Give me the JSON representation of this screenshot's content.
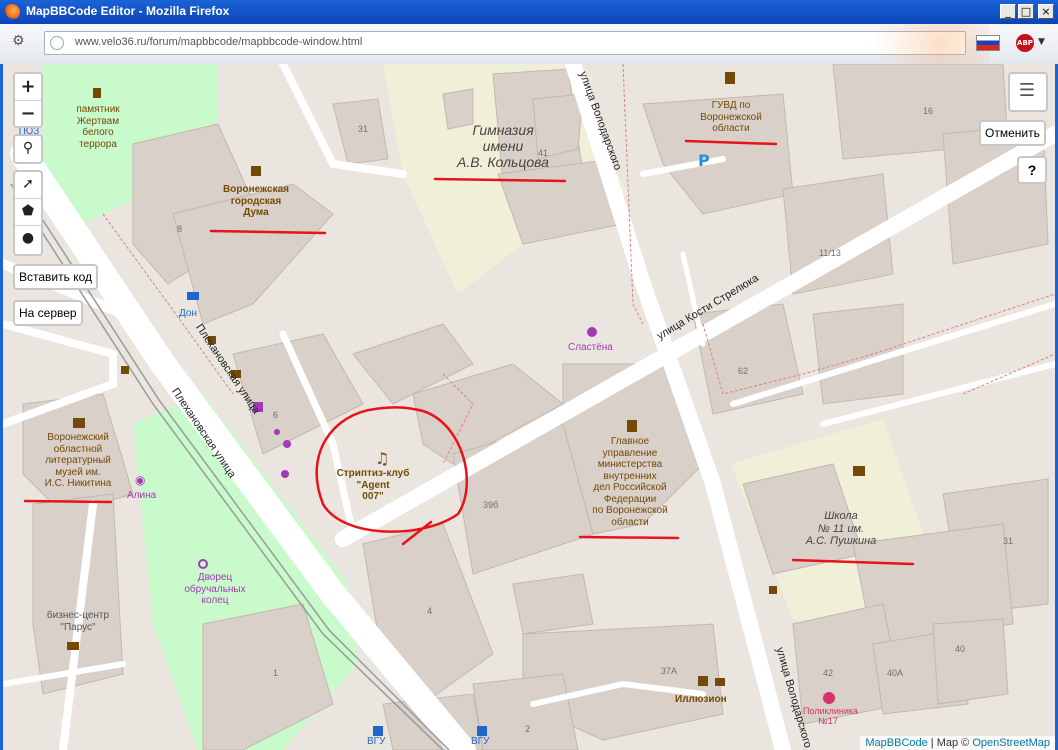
{
  "window": {
    "title": "MapBBCode Editor - Mozilla Firefox",
    "minimize": "_",
    "maximize": "□",
    "close": "×"
  },
  "address_bar": {
    "url": "www.velo36.ru/forum/mapbbcode/mapbbcode-window.html",
    "abp_label": "ABP"
  },
  "map_controls": {
    "zoom_in": "+",
    "zoom_out": "−",
    "search_icon": "search-icon",
    "line_tool_icon": "polyline-icon",
    "polygon_tool_icon": "polygon-icon",
    "marker_tool_icon": "marker-icon",
    "paste_code": "Вставить код",
    "to_server": "На сервер",
    "cancel": "Отменить",
    "help": "?",
    "layers_icon": "layers-icon"
  },
  "labels": {
    "tyoz": "ТЮЗ",
    "monument": "памятник\nЖертвам\nбелого террора",
    "duma": "Воронежская\nгородская\nДума",
    "gymnasium": "Гимназия\nимени\nА.В. Кольцова",
    "gymnasium_num": "41",
    "gvud": "ГУВД по\nВоронежской\nобласти",
    "num_16": "16",
    "num_31_top": "31",
    "num_8": "8",
    "num_1113": "11/13",
    "don": "Дон",
    "slastena": "Сластёна",
    "num_62": "62",
    "num_6": "6",
    "museum": "Воронежский\nобластной\nлитературный\nмузей им.\nИ.С. Никитина",
    "alina": "Алина",
    "club": "Стриптиз-клуб\n\"Agent\n007\"",
    "num_39b": "39б",
    "mvd": "Главное\nуправление\nминистерства\nвнутренних\nдел Российской\nФедерации\nпо Воронежской\nобласти",
    "school": "Школа\n№ 11 им.\nА.С. Пушкина",
    "num_31_right": "31",
    "palace": "Дворец\nобручальных\nколец",
    "parus": "бизнес-центр\n\"Парус\"",
    "num_4": "4",
    "num_1": "1",
    "num_37a": "37А",
    "illusion": "Иллюзион",
    "num_2": "2",
    "num_42": "42",
    "num_40a": "40А",
    "num_40": "40",
    "polyclinic": "Поликлиника\n№17",
    "vgu_1": "ВГУ",
    "vgu_2": "ВГУ"
  },
  "streets": {
    "volodarskogo_top": "улица Володарского",
    "kosti_strelyuka": "улица Кости Стрелюка",
    "plekhanovskaya_1": "Плехановская улица",
    "plekhanovskaya_2": "Плехановская улица",
    "volodarskogo_bottom": "улица Володарского"
  },
  "attribution": {
    "mapbbcode": "MapBBCode",
    "sep": " | Map © ",
    "osm": "OpenStreetMap"
  },
  "colors": {
    "building": "#d9d0c9",
    "landuse_school": "#f0f0d8",
    "park": "#c8facc",
    "road": "#ffffff",
    "annotation": "#e8121b"
  }
}
